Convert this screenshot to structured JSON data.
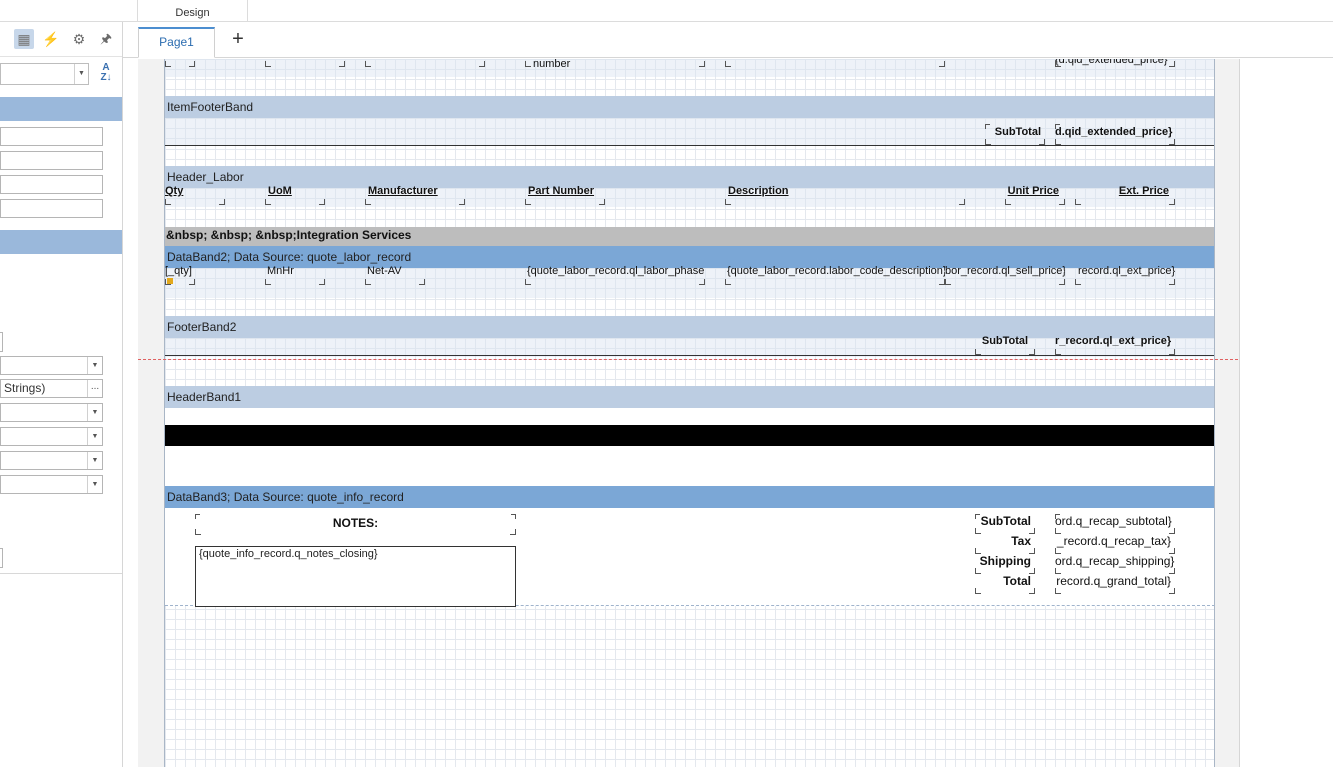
{
  "top": {
    "design_tab": "Design"
  },
  "left_panel": {
    "toolbar": [
      "properties-icon",
      "events-icon",
      "settings-icon",
      "pin-icon"
    ],
    "truncated_text": "Strings)",
    "ellipsis": "..."
  },
  "designer": {
    "page_tab": "Page1",
    "add_tab": "+",
    "top_partial": {
      "number_frag": "number",
      "ext_price_frag": "{d.qid_extended_price}"
    },
    "item_footer": {
      "title": "ItemFooterBand",
      "subtotal_label": "SubTotal",
      "subtotal_value": "d.qid_extended_price}"
    },
    "header_labor": {
      "title": "Header_Labor",
      "columns": [
        "Qty",
        "UoM",
        "Manufacturer",
        "Part Number",
        "Description",
        "Unit Price",
        "Ext. Price"
      ],
      "integration": "&nbsp; &nbsp; &nbsp;Integration Services"
    },
    "databand2": {
      "title": "DataBand2; Data Source: quote_labor_record",
      "cells": [
        "[_qty]",
        "MnHr",
        "Net-AV",
        "{quote_labor_record.ql_labor_phase",
        "{quote_labor_record.labor_code_description}",
        "bor_record.ql_sell_price}",
        "record.ql_ext_price}"
      ]
    },
    "footer2": {
      "title": "FooterBand2",
      "subtotal_label": "SubTotal",
      "subtotal_value": "r_record.ql_ext_price}"
    },
    "header1": {
      "title": "HeaderBand1"
    },
    "databand3": {
      "title": "DataBand3; Data Source: quote_info_record",
      "notes_label": "NOTES:",
      "notes_value": "{quote_info_record.q_notes_closing}",
      "summary_labels": [
        "SubTotal",
        "Tax",
        "Shipping",
        "Total"
      ],
      "summary_values": [
        "ord.q_recap_subtotal}",
        "_record.q_recap_tax}",
        "ord.q_recap_shipping}",
        "record.q_grand_total}"
      ]
    }
  }
}
